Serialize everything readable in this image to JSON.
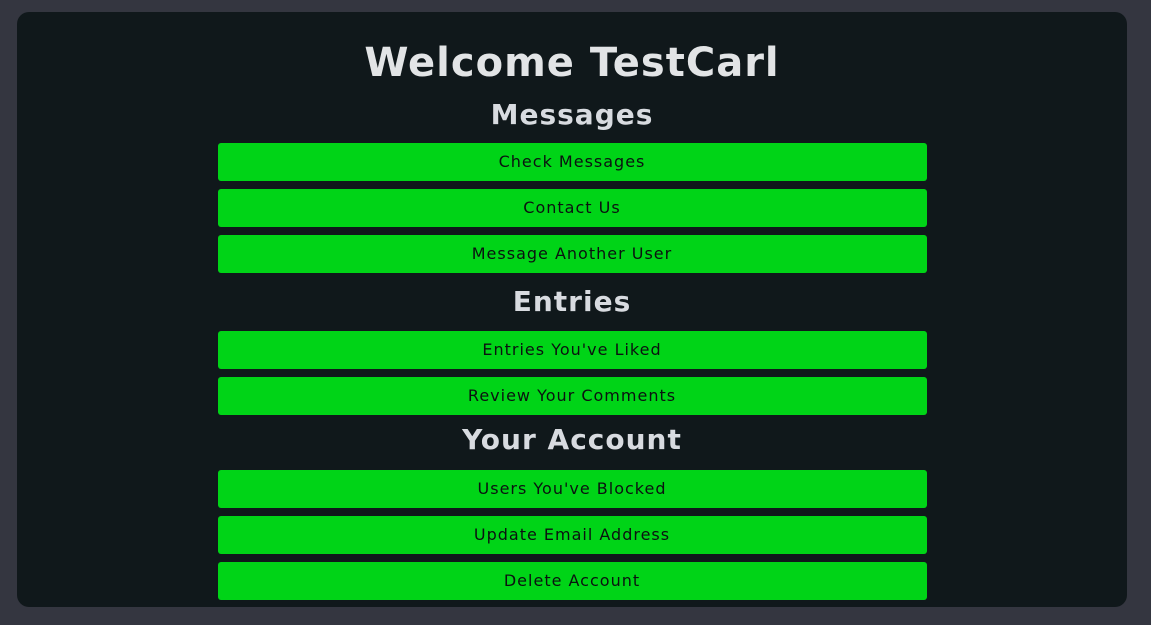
{
  "page": {
    "title": "Welcome TestCarl"
  },
  "sections": {
    "messages": {
      "heading": "Messages",
      "buttons": [
        "Check Messages",
        "Contact Us",
        "Message Another User"
      ]
    },
    "entries": {
      "heading": "Entries",
      "buttons": [
        "Entries You've Liked",
        "Review Your Comments"
      ]
    },
    "account": {
      "heading": "Your Account",
      "buttons": [
        "Users You've Blocked",
        "Update Email Address",
        "Delete Account"
      ]
    }
  },
  "colors": {
    "page_background": "#343640",
    "panel_background": "#10181b",
    "button_background": "#00d417",
    "button_text": "#0b1210",
    "heading_text": "#e2e4e6"
  }
}
